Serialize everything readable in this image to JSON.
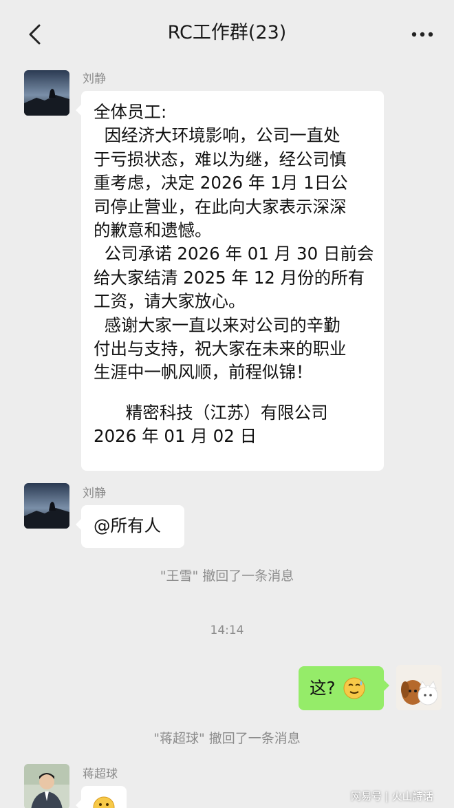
{
  "header": {
    "title": "RC工作群(23)",
    "back_icon": "chevron-left-icon",
    "more_icon": "more-dots-icon"
  },
  "messages": [
    {
      "sender": "刘静",
      "lines": [
        "全体员工:",
        "  因经济大环境影响，公司一直处",
        "于亏损状态，难以为继，经公司慎",
        "重考虑，决定 2026 年 1月 1日公",
        "司停止营业，在此向大家表示深深",
        "的歉意和遗憾。",
        "  公司承诺 2026 年 01 月 30 日前会",
        "给大家结清 2025 年 12 月份的所有",
        "工资，请大家放心。",
        "  感谢大家一直以来对公司的辛勤",
        "付出与支持，祝大家在未来的职业",
        "生涯中一帆风顺，前程似锦！",
        "",
        "      精密科技（江苏）有限公司",
        "2026 年 01 月 02 日"
      ]
    },
    {
      "sender": "刘静",
      "text": "@所有人"
    },
    {
      "system": "\"王雪\" 撤回了一条消息"
    },
    {
      "time": "14:14"
    },
    {
      "self": true,
      "text": "这?",
      "emoji": "sweat-smile-emoji"
    },
    {
      "system": "\"蒋超球\" 撤回了一条消息"
    },
    {
      "sender": "蒋超球",
      "emoji": "emoji-partial"
    }
  ],
  "watermark": "网易号 | 火山詩话",
  "colors": {
    "background": "#ededed",
    "bubble_left": "#ffffff",
    "bubble_self": "#95ec69",
    "system_text": "#8c8c8c"
  }
}
